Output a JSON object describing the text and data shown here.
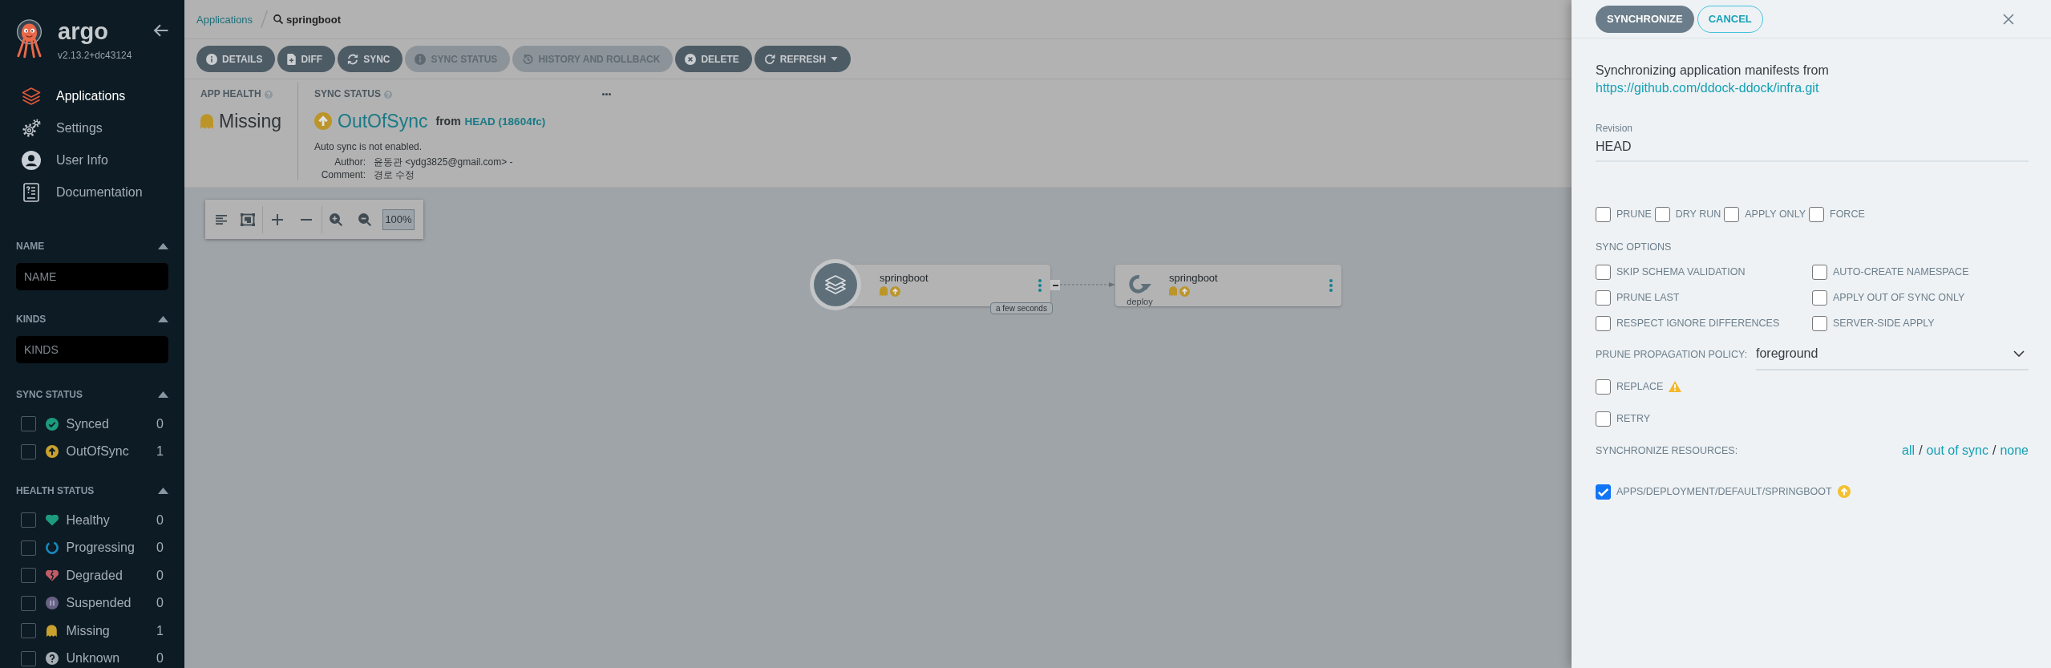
{
  "sidebar": {
    "logo": {
      "name": "argo",
      "version": "v2.13.2+dc43124"
    },
    "nav": [
      {
        "label": "Applications",
        "kind": "applications",
        "selected": true
      },
      {
        "label": "Settings",
        "kind": "settings",
        "selected": false
      },
      {
        "label": "User Info",
        "kind": "user",
        "selected": false
      },
      {
        "label": "Documentation",
        "kind": "docs",
        "selected": false
      }
    ],
    "filters": [
      {
        "kind": "text",
        "title": "NAME",
        "placeholder": "NAME"
      },
      {
        "kind": "text",
        "title": "KINDS",
        "placeholder": "KINDS"
      },
      {
        "kind": "checklist",
        "title": "SYNC STATUS",
        "items": [
          {
            "label": "Synced",
            "kind": "synced",
            "count": "0",
            "checked": false
          },
          {
            "label": "OutOfSync",
            "kind": "outofsync",
            "count": "1",
            "checked": false
          }
        ]
      },
      {
        "kind": "checklist",
        "title": "HEALTH STATUS",
        "items": [
          {
            "label": "Healthy",
            "kind": "healthy",
            "count": "0",
            "checked": false
          },
          {
            "label": "Progressing",
            "kind": "progressing",
            "count": "0",
            "checked": false
          },
          {
            "label": "Degraded",
            "kind": "degraded",
            "count": "0",
            "checked": false
          },
          {
            "label": "Suspended",
            "kind": "suspended",
            "count": "0",
            "checked": false
          },
          {
            "label": "Missing",
            "kind": "missing",
            "count": "1",
            "checked": false
          },
          {
            "label": "Unknown",
            "kind": "unknown",
            "count": "0",
            "checked": false
          }
        ]
      }
    ]
  },
  "breadcrumb": {
    "parent": "Applications",
    "current": "springboot"
  },
  "toolbar": [
    {
      "label": "DETAILS",
      "kind": "info",
      "disabled": false,
      "dropdown": false
    },
    {
      "label": "DIFF",
      "kind": "diff",
      "disabled": false,
      "dropdown": false
    },
    {
      "label": "SYNC",
      "kind": "sync",
      "disabled": false,
      "dropdown": false
    },
    {
      "label": "SYNC STATUS",
      "kind": "info",
      "disabled": true,
      "dropdown": false
    },
    {
      "label": "HISTORY AND ROLLBACK",
      "kind": "history",
      "disabled": true,
      "dropdown": false
    },
    {
      "label": "DELETE",
      "kind": "delete",
      "disabled": false,
      "dropdown": false
    },
    {
      "label": "REFRESH",
      "kind": "refresh",
      "disabled": false,
      "dropdown": true
    }
  ],
  "app_health": {
    "title": "APP HEALTH",
    "status": "Missing",
    "kind": "missing"
  },
  "sync_status": {
    "title": "SYNC STATUS",
    "status": "OutOfSync",
    "kind": "outofsync",
    "from": "from",
    "revision": "HEAD (18604fc)",
    "auto_sync": "Auto sync is not enabled.",
    "author_label": "Author:",
    "author": "윤동관 <ydg3825@gmail.com> -",
    "comment_label": "Comment:",
    "comment": "경로 수정"
  },
  "graph_toolbar": {
    "zoom": "100%"
  },
  "graph": {
    "nodes": [
      {
        "kind": "application",
        "name": "springboot",
        "health": {
          "kind": "missing"
        },
        "sync": {
          "kind": "outofsync"
        },
        "age": "a few seconds"
      },
      {
        "kind": "deployment",
        "name": "springboot",
        "type_label": "deploy",
        "health": {
          "kind": "missing"
        },
        "sync": {
          "kind": "outofsync"
        }
      }
    ]
  },
  "sync_panel": {
    "buttons": [
      {
        "label": "SYNCHRONIZE",
        "kind": "primary"
      },
      {
        "label": "CANCEL",
        "kind": "secondary"
      }
    ],
    "intro": "Synchronizing application manifests from",
    "repo_url": "https://github.com/ddock-ddock/infra.git",
    "revision": {
      "label": "Revision",
      "value": "HEAD"
    },
    "flags": [
      {
        "label": "PRUNE",
        "checked": false
      },
      {
        "label": "DRY RUN",
        "checked": false
      },
      {
        "label": "APPLY ONLY",
        "checked": false
      },
      {
        "label": "FORCE",
        "checked": false
      }
    ],
    "sync_options": {
      "title": "SYNC OPTIONS",
      "items": [
        {
          "label": "SKIP SCHEMA VALIDATION",
          "checked": false
        },
        {
          "label": "AUTO-CREATE NAMESPACE",
          "checked": false
        },
        {
          "label": "PRUNE LAST",
          "checked": false
        },
        {
          "label": "APPLY OUT OF SYNC ONLY",
          "checked": false
        },
        {
          "label": "RESPECT IGNORE DIFFERENCES",
          "checked": false
        },
        {
          "label": "SERVER-SIDE APPLY",
          "checked": false
        }
      ]
    },
    "prune_propagation_policy": {
      "label": "PRUNE PROPAGATION POLICY:",
      "value": "foreground"
    },
    "extra_options": [
      {
        "label": "REPLACE",
        "checked": false,
        "warning": true
      },
      {
        "label": "RETRY",
        "checked": false,
        "warning": false
      }
    ],
    "resources": {
      "title": "SYNCHRONIZE RESOURCES:",
      "links": [
        "all",
        "out of sync",
        "none"
      ],
      "separators": [
        "/",
        "/"
      ],
      "items": [
        {
          "label": "APPS/DEPLOYMENT/DEFAULT/SPRINGBOOT",
          "checked": true,
          "sync": {
            "kind": "outofsync"
          }
        }
      ]
    }
  }
}
